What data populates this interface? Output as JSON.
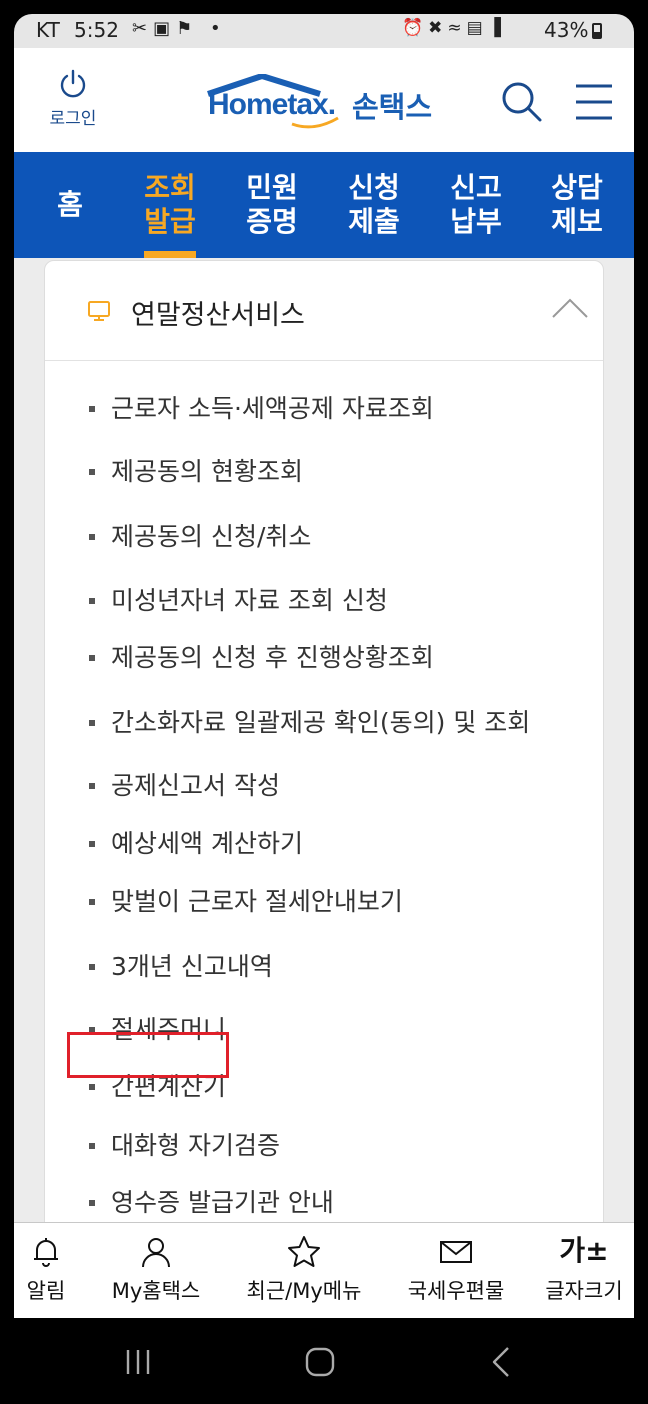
{
  "status_bar": {
    "carrier": "KT",
    "time": "5:52",
    "battery": "43%"
  },
  "header": {
    "login_label": "로그인",
    "logo_text": "Hometax.",
    "logo_korean": "손택스"
  },
  "nav": {
    "items": [
      {
        "label": "홈"
      },
      {
        "label": "조회\n발급"
      },
      {
        "label": "민원\n증명"
      },
      {
        "label": "신청\n제출"
      },
      {
        "label": "신고\n납부"
      },
      {
        "label": "상담\n제보"
      }
    ]
  },
  "card": {
    "title": "연말정산서비스",
    "items": [
      "근로자 소득·세액공제 자료조회",
      "제공동의 현황조회",
      "제공동의 신청/취소",
      "미성년자녀 자료 조회 신청",
      "제공동의 신청 후 진행상황조회",
      "간소화자료 일괄제공 확인(동의) 및 조회",
      "공제신고서 작성",
      "예상세액 계산하기",
      "맞벌이 근로자 절세안내보기",
      "3개년 신고내역",
      "절세주머니",
      "간편계산기",
      "대화형 자기검증",
      "영수증 발급기관 안내"
    ]
  },
  "tabbar": {
    "items": [
      {
        "label": "알림",
        "icon": "bell-icon"
      },
      {
        "label": "My홈택스",
        "icon": "person-icon"
      },
      {
        "label": "최근/My메뉴",
        "icon": "star-icon"
      },
      {
        "label": "국세우편물",
        "icon": "mail-icon"
      },
      {
        "label": "글자크기",
        "icon": "font-size-icon",
        "icon_text": "가±"
      }
    ]
  },
  "colors": {
    "brand_blue": "#0d55b8",
    "active_orange": "#f7a823",
    "highlight_red": "#e0202a"
  }
}
